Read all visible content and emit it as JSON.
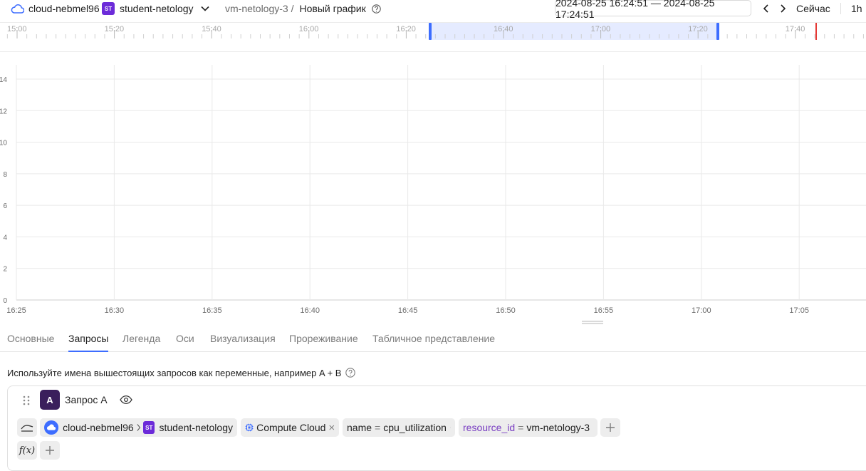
{
  "header": {
    "cloud_name": "cloud-nebmel96",
    "folder_badge": "ST",
    "folder_name": "student-netology",
    "breadcrumb_path": "vm-netology-3 /",
    "page_title": "Новый график",
    "time_range": "2024-08-25 16:24:51 — 2024-08-25 17:24:51",
    "now_label": "Сейчас",
    "period_label": "1h"
  },
  "timeline": {
    "labels": [
      "15:00",
      "15:20",
      "15:40",
      "16:00",
      "16:20",
      "16:40",
      "17:00",
      "17:20",
      "17:40"
    ]
  },
  "chart_data": {
    "type": "line",
    "series": [],
    "x": [
      "16:25",
      "16:30",
      "16:35",
      "16:40",
      "16:45",
      "16:50",
      "16:55",
      "17:00",
      "17:05"
    ],
    "xlabel": "",
    "ylabel": "",
    "yticks": [
      "0",
      "2",
      "4",
      "6",
      "8",
      "10",
      "12",
      "14"
    ],
    "ylim": [
      0,
      14
    ],
    "grid": true
  },
  "tabs": [
    {
      "label": "Основные",
      "active": false
    },
    {
      "label": "Запросы",
      "active": true
    },
    {
      "label": "Легенда",
      "active": false
    },
    {
      "label": "Оси",
      "active": false
    },
    {
      "label": "Визуализация",
      "active": false
    },
    {
      "label": "Прореживание",
      "active": false
    },
    {
      "label": "Табличное представление",
      "active": false
    }
  ],
  "hint": {
    "text": "Используйте имена вышестоящих запросов как переменные, например A  +  B"
  },
  "query": {
    "letter": "A",
    "name": "Запрос A",
    "cloud": "cloud-nebmel96",
    "folder_badge": "ST",
    "folder": "student-netology",
    "service": "Compute Cloud",
    "filter_name_key": "name",
    "filter_name_op": "=",
    "filter_name_value": "cpu_utilization",
    "filter_resource_key": "resource_id",
    "filter_resource_op": "=",
    "filter_resource_value": "vm-netology-3",
    "func_label": "f(x)"
  },
  "colors": {
    "accent": "#3d6dff",
    "selection": "#e5ebff",
    "now_marker": "#e53935",
    "folder_badge": "#6c2bd9",
    "query_letter_bg": "#3a1f5c",
    "key_purple": "#7a3fc2"
  }
}
